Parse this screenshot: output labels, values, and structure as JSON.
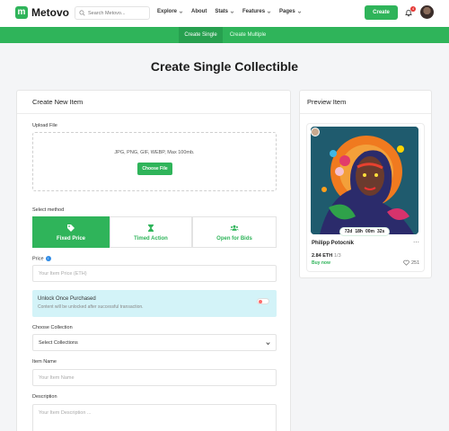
{
  "brand": {
    "logo_letter": "m",
    "name": "Metovo",
    "color": "#2fb45a"
  },
  "search": {
    "placeholder": "Search Metovo..."
  },
  "nav": {
    "links": [
      {
        "label": "Explore",
        "has_dropdown": true
      },
      {
        "label": "About",
        "has_dropdown": false
      },
      {
        "label": "Stats",
        "has_dropdown": true
      },
      {
        "label": "Features",
        "has_dropdown": true
      },
      {
        "label": "Pages",
        "has_dropdown": true
      }
    ],
    "create_label": "Create",
    "notification_count": "4"
  },
  "subnav": {
    "tabs": [
      {
        "label": "Create Single",
        "active": true
      },
      {
        "label": "Create Multiple",
        "active": false
      }
    ]
  },
  "page_title": "Create Single Collectible",
  "form": {
    "heading": "Create New Item",
    "upload": {
      "label": "Upload File",
      "hint": "JPG, PNG, GIF, WEBP, Max 100mb.",
      "button": "Choose File"
    },
    "method": {
      "label": "Select method",
      "options": [
        {
          "label": "Fixed Price",
          "icon": "tag-icon",
          "active": true
        },
        {
          "label": "Timed Action",
          "icon": "hourglass-icon",
          "active": false
        },
        {
          "label": "Open for Bids",
          "icon": "users-icon",
          "active": false
        }
      ]
    },
    "price": {
      "label": "Price",
      "placeholder": "Your Item Price (ETH)"
    },
    "unlock": {
      "title": "Unlock Once Purchased",
      "subtitle": "Content will be unlocked after successful transaction.",
      "enabled": false
    },
    "collection": {
      "label": "Choose Collection",
      "selected": "Select Collections"
    },
    "name": {
      "label": "Item Name",
      "placeholder": "Your Item Name"
    },
    "description": {
      "label": "Description",
      "placeholder": "Your Item Description ..."
    }
  },
  "preview": {
    "heading": "Preview Item",
    "timer": [
      "72d",
      "18h",
      "00m",
      "32s"
    ],
    "title": "Philipp Potocnik",
    "price": "2.84 ETH",
    "edition": "1/3",
    "buy_label": "Buy now",
    "likes": "251"
  }
}
